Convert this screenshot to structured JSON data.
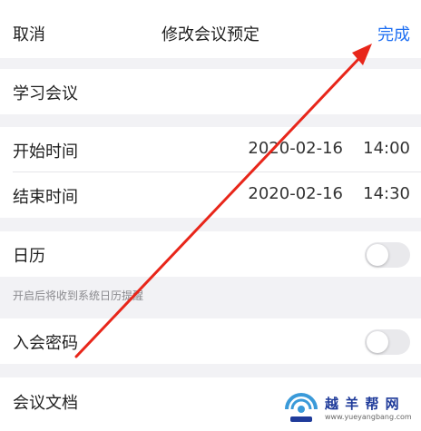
{
  "nav": {
    "cancel": "取消",
    "title": "修改会议预定",
    "done": "完成"
  },
  "meeting": {
    "topic": "学习会议"
  },
  "start": {
    "label": "开始时间",
    "date": "2020-02-16",
    "time": "14:00"
  },
  "end": {
    "label": "结束时间",
    "date": "2020-02-16",
    "time": "14:30"
  },
  "calendar": {
    "label": "日历",
    "enabled": false,
    "hint": "开启后将收到系统日历提醒"
  },
  "password": {
    "label": "入会密码",
    "enabled": false
  },
  "docs": {
    "label": "会议文档"
  },
  "watermark": {
    "name": "越 羊 帮 网",
    "url": "www.yueyangbang.com"
  },
  "colors": {
    "accent": "#1f6ff2",
    "annotation_arrow": "#e8261a",
    "background": "#f2f2f5"
  },
  "icons": [
    "toggle-switch",
    "red-annotation-arrow",
    "watermark-logo"
  ]
}
